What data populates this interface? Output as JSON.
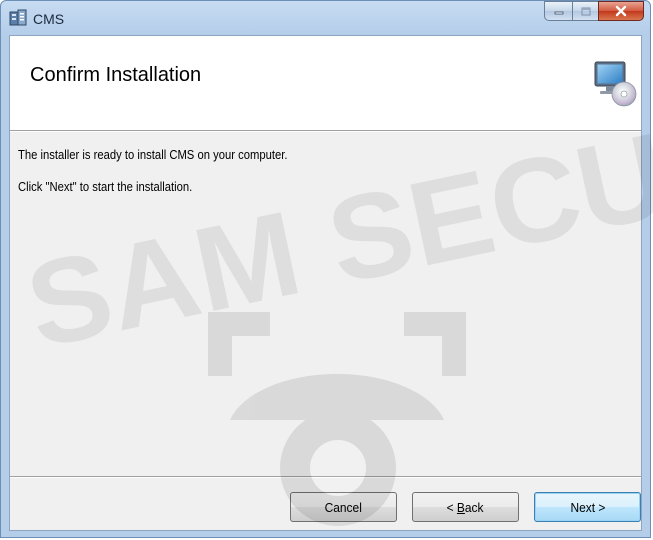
{
  "window": {
    "title": "CMS",
    "icons": {
      "app": "installer-app-icon",
      "minimize": "minimize-icon",
      "maximize": "maximize-icon",
      "close": "close-icon"
    }
  },
  "banner": {
    "title": "Confirm Installation",
    "icon": "computer-cd-icon"
  },
  "body": {
    "line1": "The installer is ready to install CMS on your computer.",
    "line2": "Click \"Next\" to start the installation."
  },
  "buttons": {
    "cancel": "Cancel",
    "back_prefix": "< ",
    "back_hotkey": "B",
    "back_rest": "ack",
    "next": "Next >"
  },
  "watermark": {
    "text": "SAM SECU",
    "icon": "dome-camera-watermark"
  },
  "colors": {
    "title_bar": "#b4cde9",
    "close_button": "#c3381c",
    "body_background": "#f0f0f0",
    "default_button_border": "#3c7fb1"
  }
}
